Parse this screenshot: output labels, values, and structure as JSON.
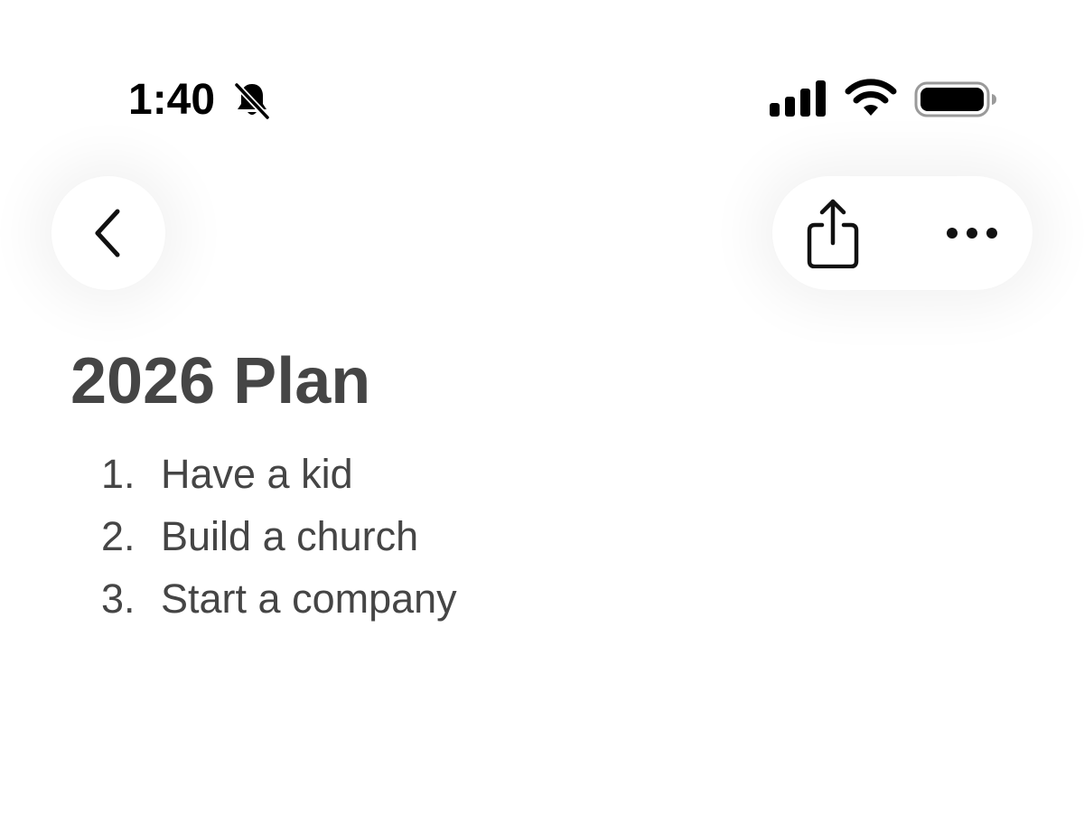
{
  "status_bar": {
    "time": "1:40",
    "icons": [
      "bell-slash-icon",
      "cellular-signal-icon",
      "wifi-icon",
      "battery-icon"
    ]
  },
  "navigation": {
    "back_icon": "chevron-left-icon",
    "share_icon": "share-icon",
    "more_icon": "ellipsis-icon"
  },
  "note": {
    "title": "2026 Plan",
    "items": [
      {
        "number": "1.",
        "text": "Have a kid"
      },
      {
        "number": "2.",
        "text": "Build a church"
      },
      {
        "number": "3.",
        "text": "Start a company"
      }
    ]
  },
  "colors": {
    "text": "#454545",
    "background": "#ffffff",
    "status": "#000000"
  }
}
